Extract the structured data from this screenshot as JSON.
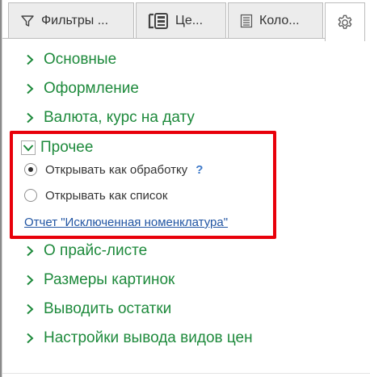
{
  "tabs": {
    "filters_label": "Фильтры ...",
    "groups_label": "Це...",
    "columns_label": "Коло...",
    "settings_icon": "gear-icon"
  },
  "tree": {
    "nodes_top": [
      {
        "label": "Основные",
        "expanded": false
      },
      {
        "label": "Оформление",
        "expanded": false
      },
      {
        "label": "Валюта, курс на дату",
        "expanded": false
      }
    ],
    "expanded_node": {
      "label": "Прочее",
      "expanded": true,
      "radio_options": [
        {
          "label": "Открывать как обработку",
          "selected": true
        },
        {
          "label": "Открывать как список",
          "selected": false
        }
      ],
      "help_symbol": "?",
      "report_link": "Отчет \"Исключенная номенклатура\""
    },
    "nodes_bottom": [
      {
        "label": "О прайс-листе",
        "expanded": false
      },
      {
        "label": "Размеры картинок",
        "expanded": false
      },
      {
        "label": "Выводить остатки",
        "expanded": false
      },
      {
        "label": "Настройки вывода видов цен",
        "expanded": false
      }
    ]
  },
  "colors": {
    "node_green": "#1e8a3c",
    "link_blue": "#2155a3",
    "highlight_red": "#e8000a"
  }
}
